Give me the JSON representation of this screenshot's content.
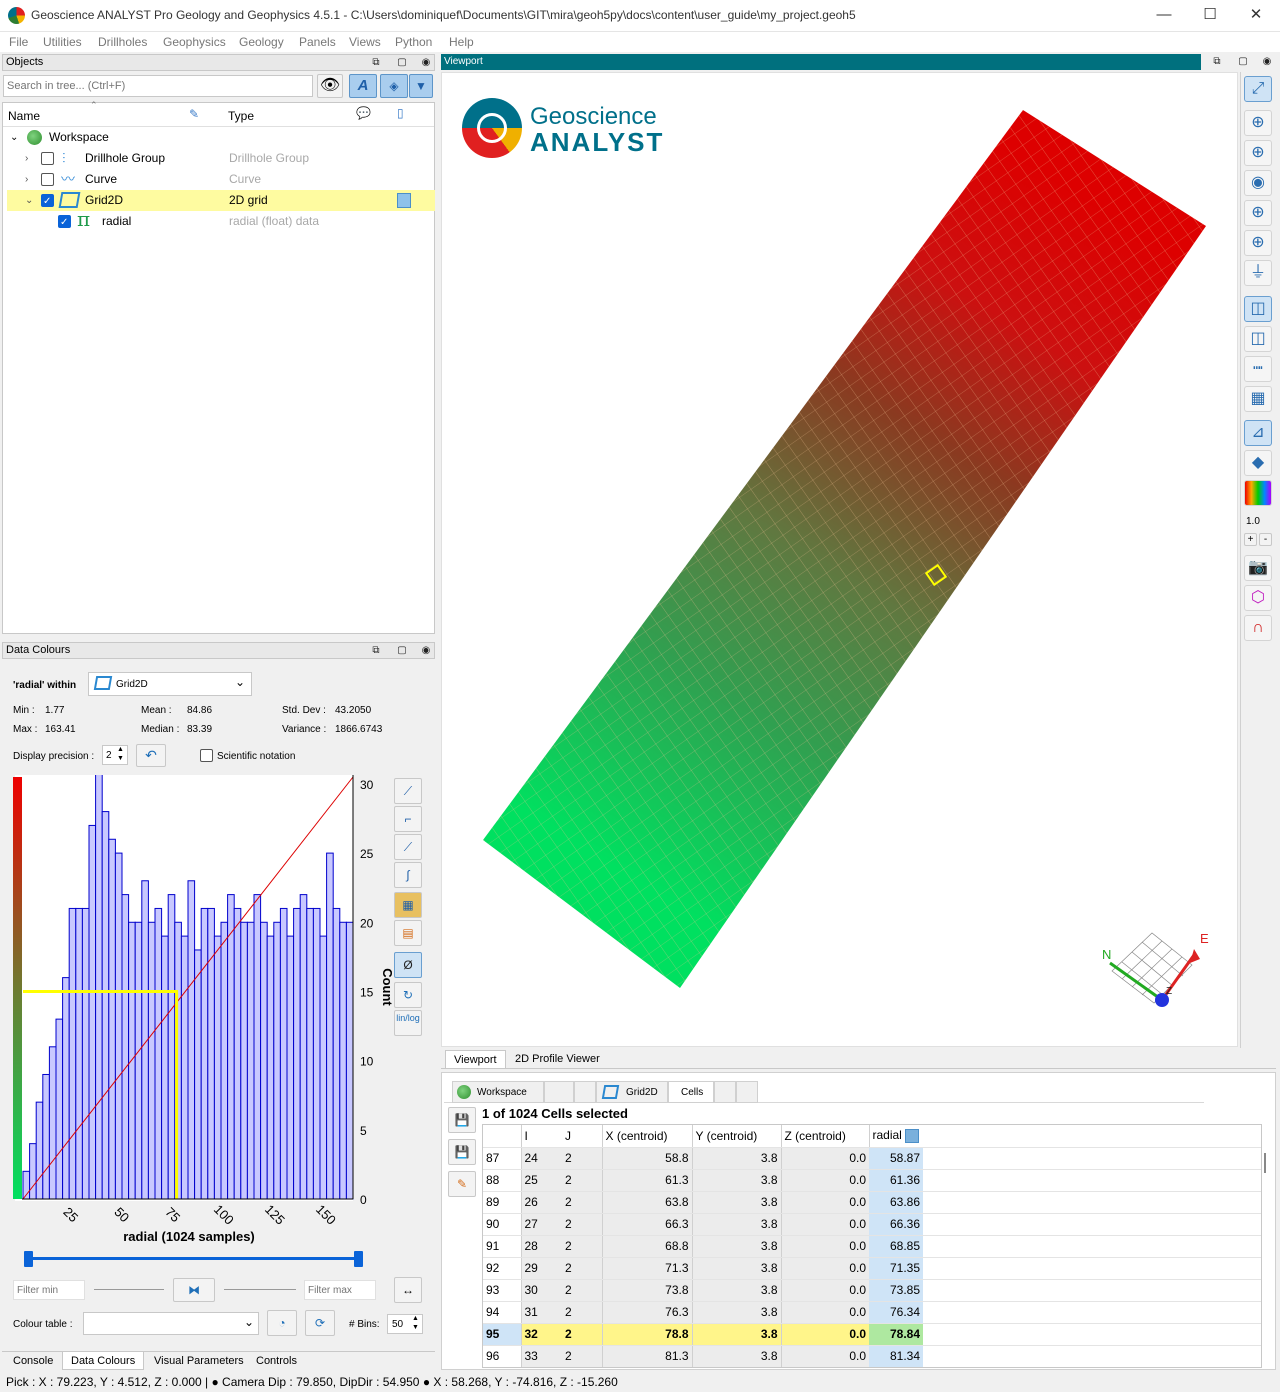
{
  "window": {
    "title": "Geoscience ANALYST Pro Geology and Geophysics 4.5.1 - C:\\Users\\dominiquef\\Documents\\GIT\\mira\\geoh5py\\docs\\content\\user_guide\\my_project.geoh5",
    "minimize": "—",
    "maximize": "☐",
    "close": "✕"
  },
  "menu": [
    "File",
    "Utilities",
    "Drillholes",
    "Geophysics",
    "Geology",
    "Panels",
    "Views",
    "Python",
    "Help"
  ],
  "objects_panel": {
    "title": "Objects",
    "search_placeholder": "Search in tree... (Ctrl+F)",
    "col_name": "Name",
    "col_type": "Type",
    "rows": [
      {
        "name": "Workspace",
        "type": ""
      },
      {
        "name": "Drillhole Group",
        "type": "Drillhole Group"
      },
      {
        "name": "Curve",
        "type": "Curve"
      },
      {
        "name": "Grid2D",
        "type": "2D grid"
      },
      {
        "name": "radial",
        "type": "radial (float) data"
      }
    ]
  },
  "data_colours": {
    "title": "Data Colours",
    "within_label": "'radial' within",
    "within_value": "Grid2D",
    "min_label": "Min :",
    "min": "1.77",
    "max_label": "Max :",
    "max": "163.41",
    "mean_label": "Mean :",
    "mean": "84.86",
    "median_label": "Median :",
    "median": "83.39",
    "std_label": "Std. Dev :",
    "std": "43.2050",
    "var_label": "Variance :",
    "var": "1866.6743",
    "precision_label": "Display precision :",
    "precision_value": "2",
    "sci_label": "Scientific notation",
    "filter_min_placeholder": "Filter min",
    "filter_max_placeholder": "Filter max",
    "colour_table_label": "Colour table :",
    "bins_label": "# Bins:",
    "bins_value": "50",
    "linlog": "lin/log",
    "count_label": "Count"
  },
  "chart_data": {
    "type": "bar",
    "xlabel": "radial (1024 samples)",
    "ylabel": "Count",
    "xlim": [
      1.77,
      163.41
    ],
    "ylim": [
      0,
      30.5
    ],
    "xticks": [
      25,
      50,
      75,
      100,
      125,
      150
    ],
    "yticks": [
      0,
      5,
      10,
      15,
      20,
      25,
      30
    ],
    "values": [
      2,
      4,
      7,
      9,
      11,
      13,
      16,
      21,
      21,
      21,
      27,
      31,
      28,
      26,
      25,
      22,
      20,
      20,
      23,
      20,
      21,
      19,
      22,
      20,
      19,
      23,
      18,
      21,
      21,
      19,
      20,
      22,
      21,
      20,
      20,
      22,
      20,
      19,
      20,
      21,
      19,
      21,
      22,
      21,
      21,
      19,
      25,
      21,
      20,
      20
    ],
    "cursor_x": 77,
    "cursor_y": 15
  },
  "bottom_tabs_left": [
    "Console",
    "Data Colours",
    "Visual Parameters",
    "Controls"
  ],
  "viewport": {
    "title": "Viewport",
    "logo_line1": "Geoscience",
    "logo_line2": "ANALYST",
    "axis_n": "N",
    "axis_e": "E",
    "axis_z": "Z",
    "zoom_value": "1.0"
  },
  "viewport_tabs": [
    "Viewport",
    "2D Profile Viewer"
  ],
  "cells_tabs": [
    "Workspace",
    "Grid2D",
    "Cells"
  ],
  "cells": {
    "selection_text": "1 of 1024 Cells selected",
    "columns": [
      "",
      "I",
      "J",
      "X (centroid)",
      "Y (centroid)",
      "Z (centroid)",
      "radial"
    ],
    "rows": [
      [
        "87",
        "24",
        "2",
        "58.8",
        "3.8",
        "0.0",
        "58.87"
      ],
      [
        "88",
        "25",
        "2",
        "61.3",
        "3.8",
        "0.0",
        "61.36"
      ],
      [
        "89",
        "26",
        "2",
        "63.8",
        "3.8",
        "0.0",
        "63.86"
      ],
      [
        "90",
        "27",
        "2",
        "66.3",
        "3.8",
        "0.0",
        "66.36"
      ],
      [
        "91",
        "28",
        "2",
        "68.8",
        "3.8",
        "0.0",
        "68.85"
      ],
      [
        "92",
        "29",
        "2",
        "71.3",
        "3.8",
        "0.0",
        "71.35"
      ],
      [
        "93",
        "30",
        "2",
        "73.8",
        "3.8",
        "0.0",
        "73.85"
      ],
      [
        "94",
        "31",
        "2",
        "76.3",
        "3.8",
        "0.0",
        "76.34"
      ],
      [
        "95",
        "32",
        "2",
        "78.8",
        "3.8",
        "0.0",
        "78.84"
      ],
      [
        "96",
        "33",
        "2",
        "81.3",
        "3.8",
        "0.0",
        "81.34"
      ]
    ],
    "selected_row": "95"
  },
  "status": "Pick : X : 79.223, Y : 4.512, Z : 0.000 |  ●  Camera Dip : 79.850, DipDir : 54.950  ●  X : 58.268, Y : -74.816, Z : -15.260",
  "colors": {
    "viewport_header": "#00707e",
    "grid_red": "#dd0000",
    "grid_green": "#00e060",
    "hist_bar": "#0000cc",
    "hist_fill": "#c8c8ff",
    "selected_row": "#fff58a",
    "radial_col": "#cfe4f7"
  }
}
